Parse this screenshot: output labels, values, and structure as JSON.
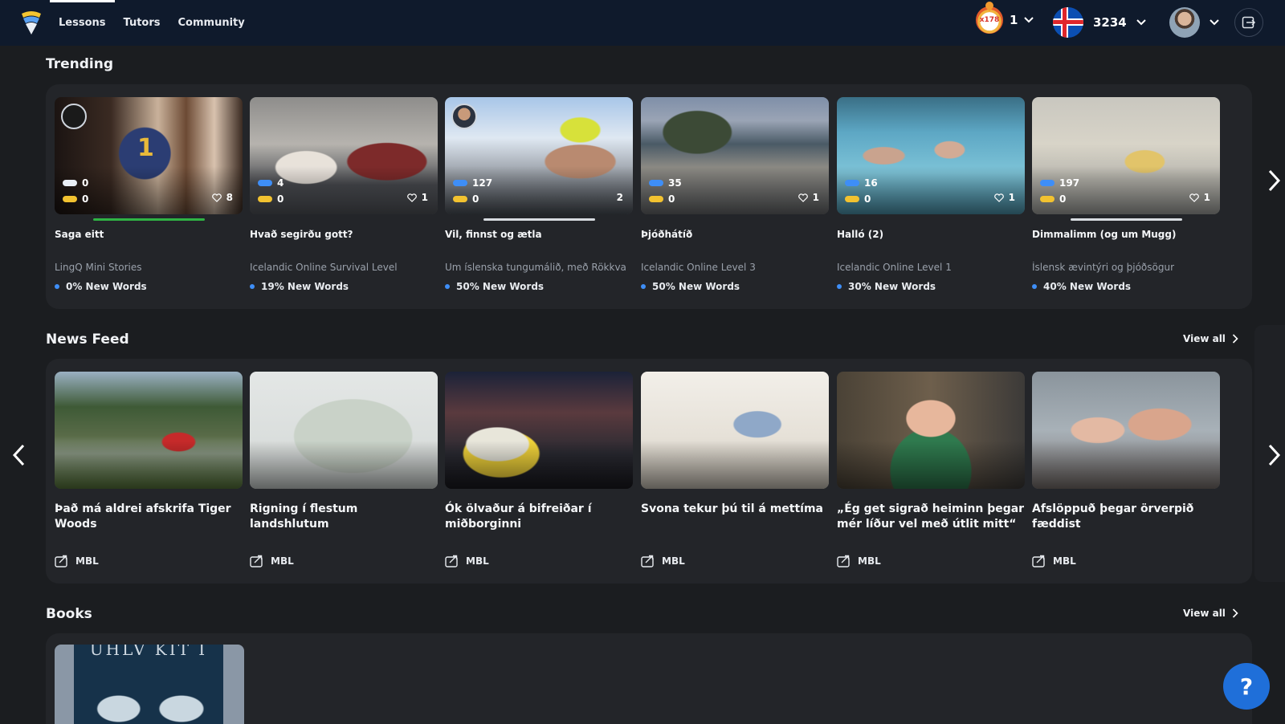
{
  "nav": {
    "items": [
      {
        "label": "Lessons",
        "active": true
      },
      {
        "label": "Tutors",
        "active": false
      },
      {
        "label": "Community",
        "active": false
      }
    ]
  },
  "topbar": {
    "streak_badge": "x178",
    "streak_count": "1",
    "coins": "3234"
  },
  "trending": {
    "title": "Trending",
    "cards": [
      {
        "title": "Saga eitt",
        "source": "LingQ Mini Stories",
        "new_words": "0% New Words",
        "blue": "0",
        "yellow": "0",
        "likes": "8",
        "progress_color": "#2fb344"
      },
      {
        "title": "Hvað segirðu gott?",
        "source": "Icelandic Online Survival Level",
        "new_words": "19% New Words",
        "blue": "4",
        "yellow": "0",
        "likes": "1"
      },
      {
        "title": "Vil, finnst og ætla",
        "source": "Um íslenska tungumálið, með Rökkva",
        "new_words": "50% New Words",
        "blue": "127",
        "yellow": "0",
        "likes": "2",
        "progress_color": "#d7dbe0"
      },
      {
        "title": "Þjóðhátíð",
        "source": "Icelandic Online Level 3",
        "new_words": "50% New Words",
        "blue": "35",
        "yellow": "0",
        "likes": "1"
      },
      {
        "title": "Halló (2)",
        "source": "Icelandic Online Level 1",
        "new_words": "30% New Words",
        "blue": "16",
        "yellow": "0",
        "likes": "1"
      },
      {
        "title": "Dimmalimm (og um Mugg)",
        "source": "Íslensk ævintýri og þjóðsögur",
        "new_words": "40% New Words",
        "blue": "197",
        "yellow": "0",
        "likes": "1",
        "progress_color": "#d7dbe0"
      }
    ]
  },
  "news": {
    "title": "News Feed",
    "view_all": "View all",
    "cards": [
      {
        "title": "Það má aldrei afskrifa Tiger Woods",
        "source": "MBL"
      },
      {
        "title": "Rigning í flestum landshlutum",
        "source": "MBL"
      },
      {
        "title": "Ók ölvaður á bifreiðar í miðborginni",
        "source": "MBL"
      },
      {
        "title": "Svona tekur þú til á mettíma",
        "source": "MBL"
      },
      {
        "title": "„Ég get sigrað heiminn þegar mér líður vel með útlit mitt“",
        "source": "MBL"
      },
      {
        "title": "Afslöppuð þegar örverpið fæddist",
        "source": "MBL"
      }
    ]
  },
  "books": {
    "title": "Books",
    "view_all": "View all",
    "cover_text": "ÚHLV KIT I"
  },
  "help": {
    "label": "?"
  },
  "colors": {
    "accent": "#3e8ef7",
    "yellow": "#f2c230",
    "topbar": "#0f1a2c",
    "help": "#1f6fd9"
  },
  "icons": {
    "logo": "lingq-logo-icon",
    "chevron": "chevron-down-icon",
    "heart": "heart-icon",
    "source": "external-source-icon",
    "arrow_right": "chevron-right-icon",
    "arrow_left": "chevron-left-icon",
    "logout": "logout-icon"
  }
}
